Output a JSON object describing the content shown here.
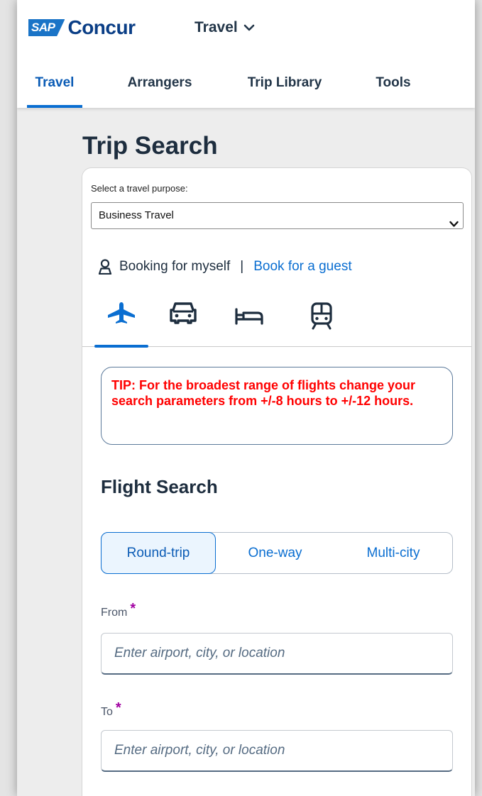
{
  "header": {
    "logo_sap": "SAP",
    "logo_concur": "Concur",
    "product": "Travel"
  },
  "nav": {
    "items": [
      {
        "label": "Travel",
        "active": true
      },
      {
        "label": "Arrangers",
        "active": false
      },
      {
        "label": "Trip Library",
        "active": false
      },
      {
        "label": "Tools",
        "active": false
      }
    ]
  },
  "page": {
    "title": "Trip Search"
  },
  "purpose": {
    "label": "Select a travel purpose:",
    "selected": "Business Travel"
  },
  "booking": {
    "self": "Booking for myself",
    "separator": "|",
    "guest_link": "Book for a guest"
  },
  "mode_tabs": [
    {
      "icon": "airplane-icon",
      "active": true
    },
    {
      "icon": "car-icon",
      "active": false
    },
    {
      "icon": "bed-icon",
      "active": false
    },
    {
      "icon": "train-icon",
      "active": false
    }
  ],
  "tip": {
    "text": "TIP: For the broadest range of flights change your search parameters from +/-8 hours to +/-12 hours."
  },
  "flight_search": {
    "title": "Flight Search",
    "trip_types": [
      "Round-trip",
      "One-way",
      "Multi-city"
    ],
    "selected_trip_type": "Round-trip",
    "from": {
      "label": "From",
      "required": "*",
      "placeholder": "Enter airport, city, or location"
    },
    "to": {
      "label": "To",
      "required": "*",
      "placeholder": "Enter airport, city, or location"
    }
  },
  "colors": {
    "accent": "#0a6ed1",
    "tip_text": "#ff0000",
    "required": "#a100a1",
    "brand_dark": "#0a3e86"
  }
}
